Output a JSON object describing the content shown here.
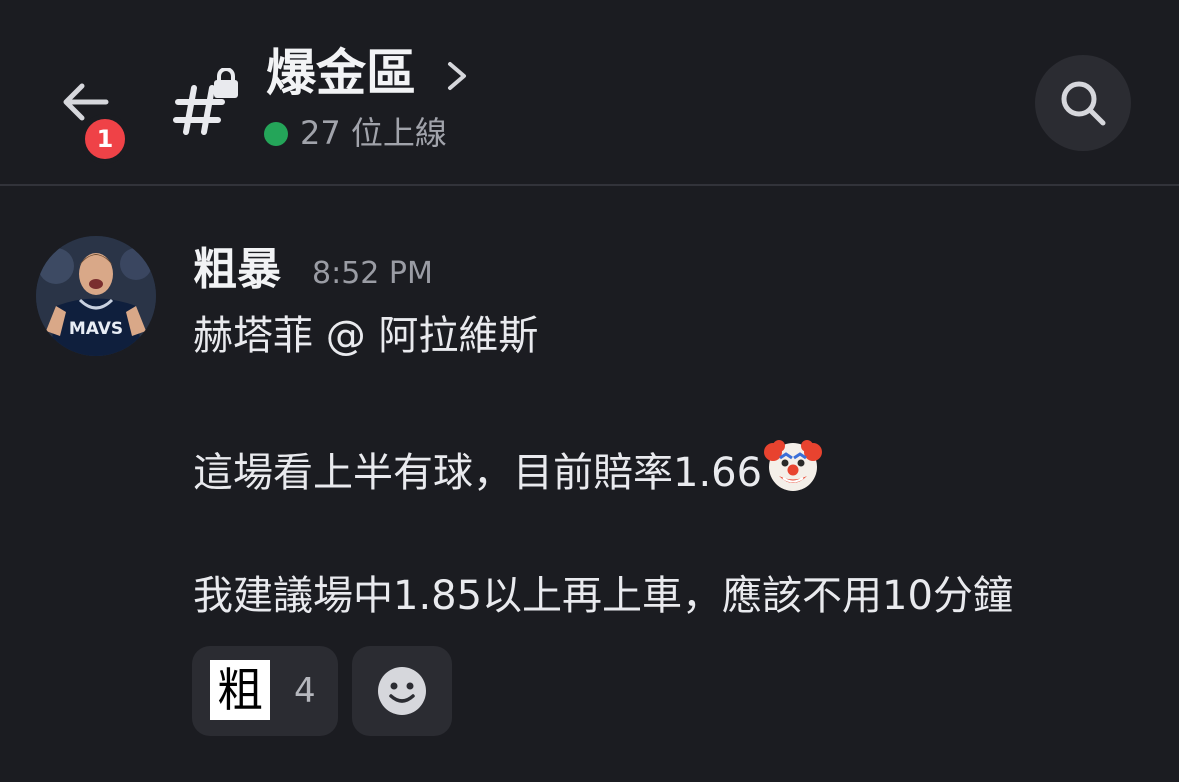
{
  "header": {
    "back_icon": "arrow-left-icon",
    "unread_badge": "1",
    "channel_icon": "locked-hashtag-icon",
    "channel_name": "爆金區",
    "chevron_icon": "chevron-right-icon",
    "online_status": "27 位上線",
    "search_icon": "search-icon"
  },
  "message": {
    "author": "粗暴",
    "timestamp": "8:52 PM",
    "lines": [
      "赫塔菲 @ 阿拉維斯",
      "",
      "這場看上半有球，目前賠率1.66",
      "",
      "我建議場中1.85以上再上車，應該不用10分鐘"
    ],
    "inline_emoji": "clown-face-emoji"
  },
  "reactions": [
    {
      "emoji": "粗",
      "count": "4"
    }
  ],
  "add_reaction_icon": "smiley-icon",
  "colors": {
    "background": "#1b1c21",
    "badge": "#ef4247",
    "online": "#24a559",
    "surface": "#2b2c32"
  }
}
